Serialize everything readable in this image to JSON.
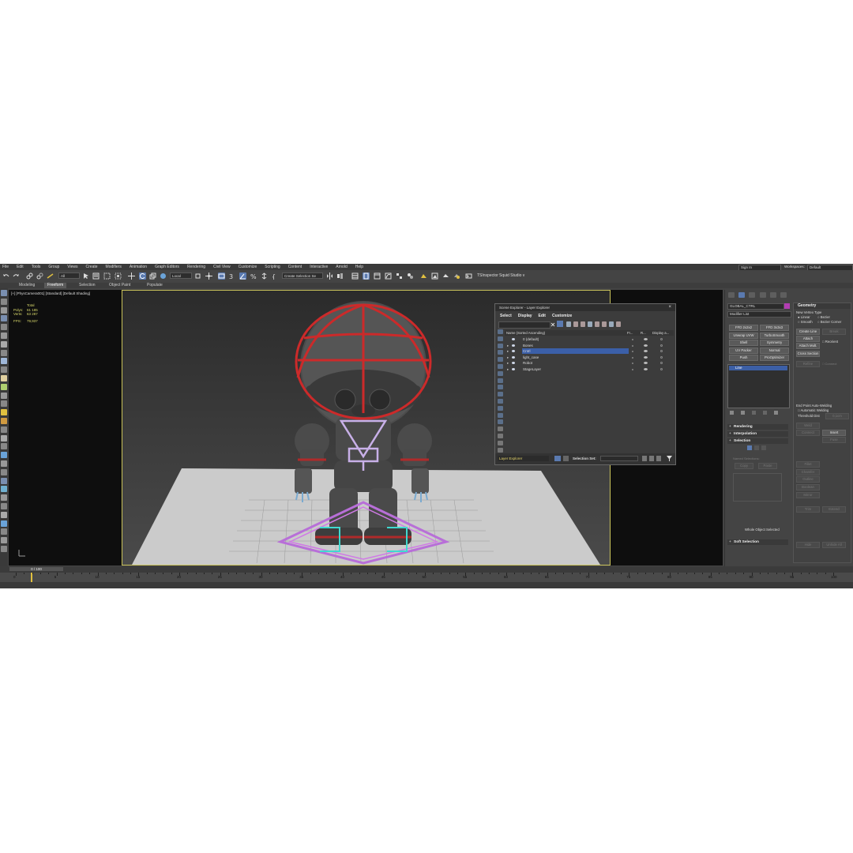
{
  "menu": [
    "File",
    "Edit",
    "Tools",
    "Group",
    "Views",
    "Create",
    "Modifiers",
    "Animation",
    "Graph Editors",
    "Rendering",
    "Civil View",
    "Customize",
    "Scripting",
    "Content",
    "Interactive",
    "Arnold",
    "Help"
  ],
  "sign_in": "Sign In",
  "workspaces_label": "Workspaces:",
  "workspace_value": "Default",
  "toolbar": {
    "filter_value": "All",
    "coord_value": "Local",
    "selection_set": "Create Selection Se",
    "tsinspector": "TSInspector",
    "squid_studio": "Squid Studio v"
  },
  "ribbon_tabs": [
    "Modeling",
    "Freeform",
    "Selection",
    "Object Paint",
    "Populate"
  ],
  "ribbon_active": "Freeform",
  "viewport": {
    "label": "[+] [PhysCamera001] [Standard] [Default Shading]",
    "stats_title": "Total",
    "polys_label": "Polys:",
    "polys_value": "61 185",
    "verts_label": "Verts:",
    "verts_value": "63 287",
    "fps_label": "FPS:",
    "fps_value": "79,937"
  },
  "scene_explorer": {
    "title": "Scene Explorer - Layer Explorer",
    "menu": [
      "Select",
      "Display",
      "Edit",
      "Customize"
    ],
    "column_name": "Name (Sorted Ascending)",
    "column_fr": "Fr...",
    "column_r": "R...",
    "column_display": "Display a...",
    "layers": [
      "0 (default)",
      "Bones",
      "Cntrl",
      "light_case",
      "Robot",
      "StageLayer"
    ],
    "selected_layer": "Cntrl",
    "footer_dropdown": "Layer Explorer",
    "selection_set_label": "Selection Set:"
  },
  "command_panel": {
    "object_name": "GLOBAL_CTRL",
    "object_color": "#b23db2",
    "modifier_list": "Modifier List",
    "modifier_buttons": [
      "FFD 2x2x2",
      "FFD 3x3x3",
      "Unwrap UVW",
      "TurboSmooth",
      "Shell",
      "Symmetry",
      "UV Packer",
      "Normal",
      "Push",
      "ProOptimizer"
    ],
    "stack_item": "Line",
    "rollouts": [
      "Rendering",
      "Interpolation",
      "Selection",
      "Soft Selection"
    ],
    "named_selections": "Named Selections:",
    "copy": "Copy",
    "paste": "Paste",
    "whole_object_selected": "Whole Object Selected"
  },
  "geometry": {
    "title": "Geometry",
    "new_vertex_type": "New Vertex Type",
    "linear": "Linear",
    "bezier": "Bezier",
    "smooth": "Smooth",
    "bezier_corner": "Bezier Corner",
    "create_line": "Create Line",
    "break": "Break",
    "attach": "Attach",
    "reorient": "Reorient",
    "attach_mult": "Attach Mult.",
    "cross_section": "Cross Section",
    "refine": "Refine",
    "connect": "Connect",
    "end_point_auto_welding": "End Point Auto-Welding",
    "automatic_welding": "Automatic Welding",
    "threshold_dist": "Threshold Dist",
    "threshold_value": "0,1cm",
    "weld": "Weld",
    "insert": "Insert",
    "fuse": "Fuse",
    "mirror": "Mirror",
    "trim": "Trim",
    "extend": "Extend",
    "fillet": "Fillet",
    "chamfer": "Chamfer",
    "outline": "Outline",
    "boolean": "Boolean",
    "hide": "Hide",
    "unhide_all": "Unhide All"
  },
  "timeline": {
    "frame_display": "0 / 100",
    "ticks": [
      "0",
      "5",
      "10",
      "15",
      "20",
      "25",
      "30",
      "35",
      "40",
      "45",
      "50",
      "55",
      "60",
      "65",
      "70",
      "75",
      "80",
      "85",
      "90",
      "95",
      "100"
    ]
  },
  "colors": {
    "accent_selection": "#3b5fa8",
    "viewport_border": "#c9c25a",
    "control_red": "#cc2a2a",
    "control_purple": "#b86fd8",
    "control_cyan": "#40d9d0"
  }
}
